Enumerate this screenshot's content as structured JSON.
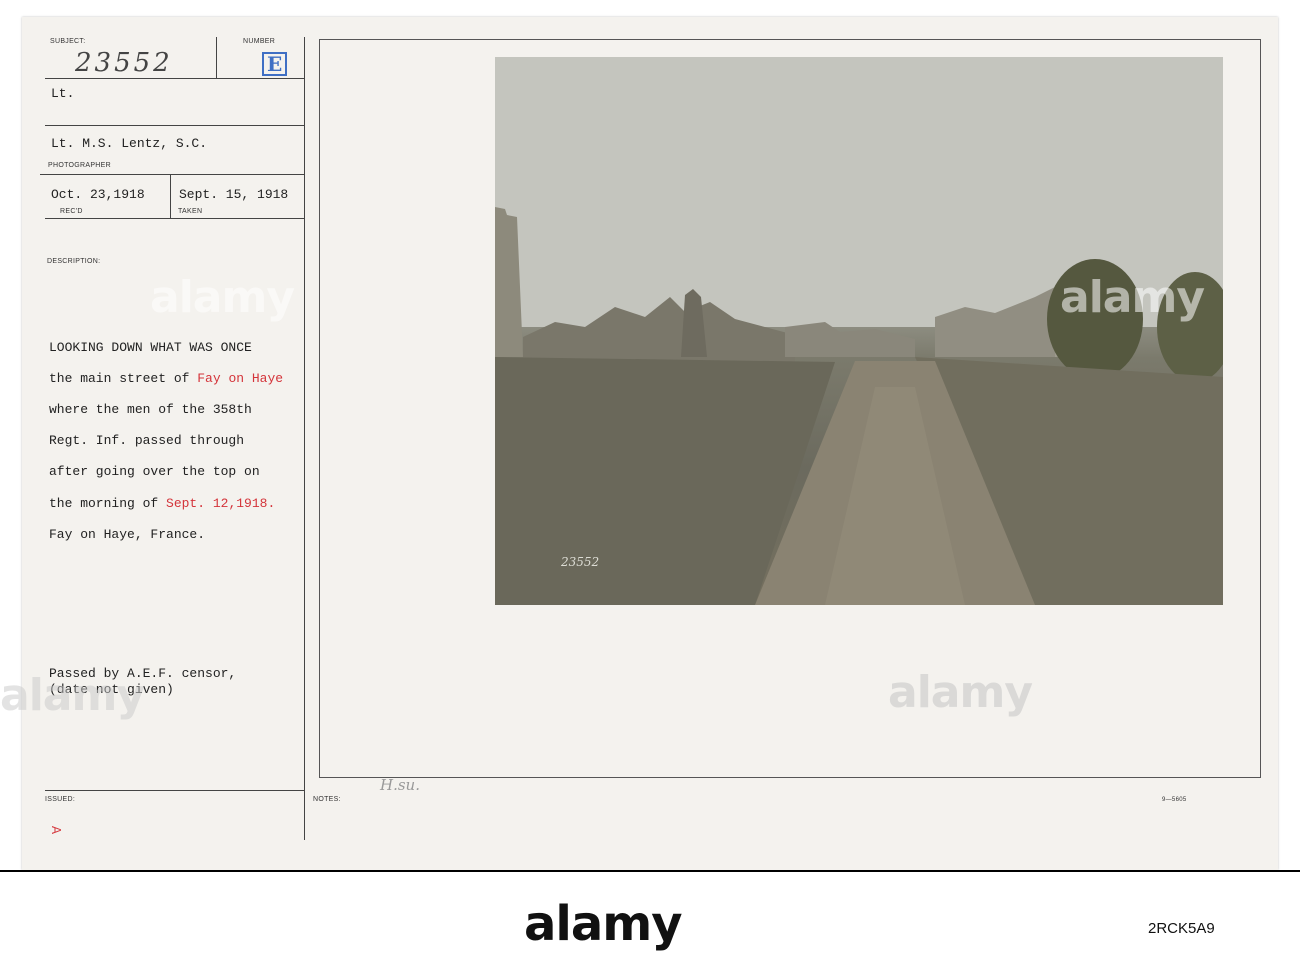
{
  "card": {
    "subject_label": "SUBJECT:",
    "subject_number": "23552",
    "number_label": "NUMBER",
    "number_stamp": "E",
    "rank": "Lt.",
    "photographer": "Lt. M.S. Lentz, S.C.",
    "photographer_label": "PHOTOGRAPHER",
    "received_date": "Oct. 23,1918",
    "received_label": "REC'D",
    "taken_date": "Sept. 15, 1918",
    "taken_label": "TAKEN",
    "description_label": "DESCRIPTION:",
    "description_lines": {
      "l1": "LOOKING DOWN WHAT WAS ONCE",
      "l2a": "the main street of ",
      "l2b": "Fay on Haye",
      "l3": "where the men of the 358th",
      "l4": "Regt. Inf. passed through",
      "l5": "after going over the top on",
      "l6a": "the morning of ",
      "l6b": "Sept. 12,1918.",
      "l7": "Fay on Haye, France."
    },
    "censor_line1": "Passed by A.E.F. censor,",
    "censor_line2": "(date not given)",
    "issued_label": "ISSUED:",
    "notes_label": "NOTES:",
    "issued_mark": "A",
    "notes_handwriting": "H.su.",
    "form_number": "9—5605"
  },
  "photo": {
    "caption_number": "23552",
    "description": "Ruined village street with rubble and rough dirt road"
  },
  "watermarks": [
    "alamy",
    "alamy",
    "alamy",
    "alamy"
  ],
  "stamp": {
    "brand": "alamy",
    "image_id": "2RCK5A9"
  },
  "colors": {
    "card": "#f4f2ee",
    "red_ink": "#d4343a",
    "blue_stamp": "#3f6fc4"
  }
}
